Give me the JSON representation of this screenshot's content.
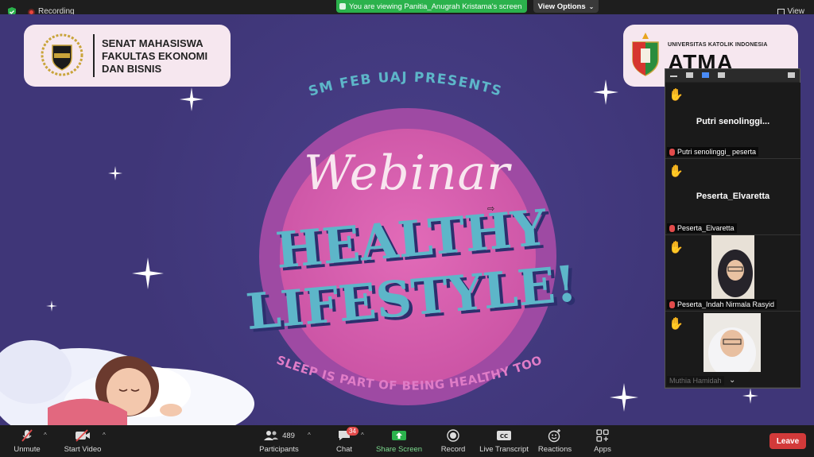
{
  "topbar": {
    "recording_label": "Recording",
    "viewing_banner": "You are viewing Panitia_Anugrah Kristama's screen",
    "view_options_label": "View Options",
    "view_label": "View"
  },
  "slide": {
    "org_lines": [
      "SENAT MAHASISWA",
      "FAKULTAS EKONOMI",
      "DAN BISNIS"
    ],
    "org_logo_text": "SEMFEB",
    "uni_small": "UNIVERSITAS KATOLIK INDONESIA",
    "uni_big": "ATMA JAYA",
    "presents": "SM FEB UAJ PRESENTS",
    "webinar": "Webinar",
    "title_line1": "HEALTHY",
    "title_line2": "LIFESTYLE!",
    "tagline": "SLEEP IS  PART OF BEING HEALTHY TOO"
  },
  "gallery": {
    "tiles": [
      {
        "center_name": "Putri  senolinggi...",
        "tag": "Putri senolinggi_ peserta"
      },
      {
        "center_name": "Peserta_Elvaretta",
        "tag": "Peserta_Elvaretta"
      },
      {
        "center_name": "",
        "tag": "Peserta_Indah Nirmala Rasyid"
      },
      {
        "center_name": "",
        "tag": "Muthia Hamidah"
      }
    ]
  },
  "toolbar": {
    "unmute": "Unmute",
    "start_video": "Start Video",
    "participants": "Participants",
    "participants_count": "489",
    "chat": "Chat",
    "chat_badge": "34",
    "share_screen": "Share Screen",
    "record": "Record",
    "live_transcript": "Live Transcript",
    "reactions": "Reactions",
    "apps": "Apps",
    "leave": "Leave"
  },
  "colors": {
    "slide_bg": "#3f3678",
    "accent_teal": "#5db6c9",
    "accent_pink": "#d55aa9",
    "share_green": "#2bb24c",
    "leave_red": "#d23a3a"
  }
}
